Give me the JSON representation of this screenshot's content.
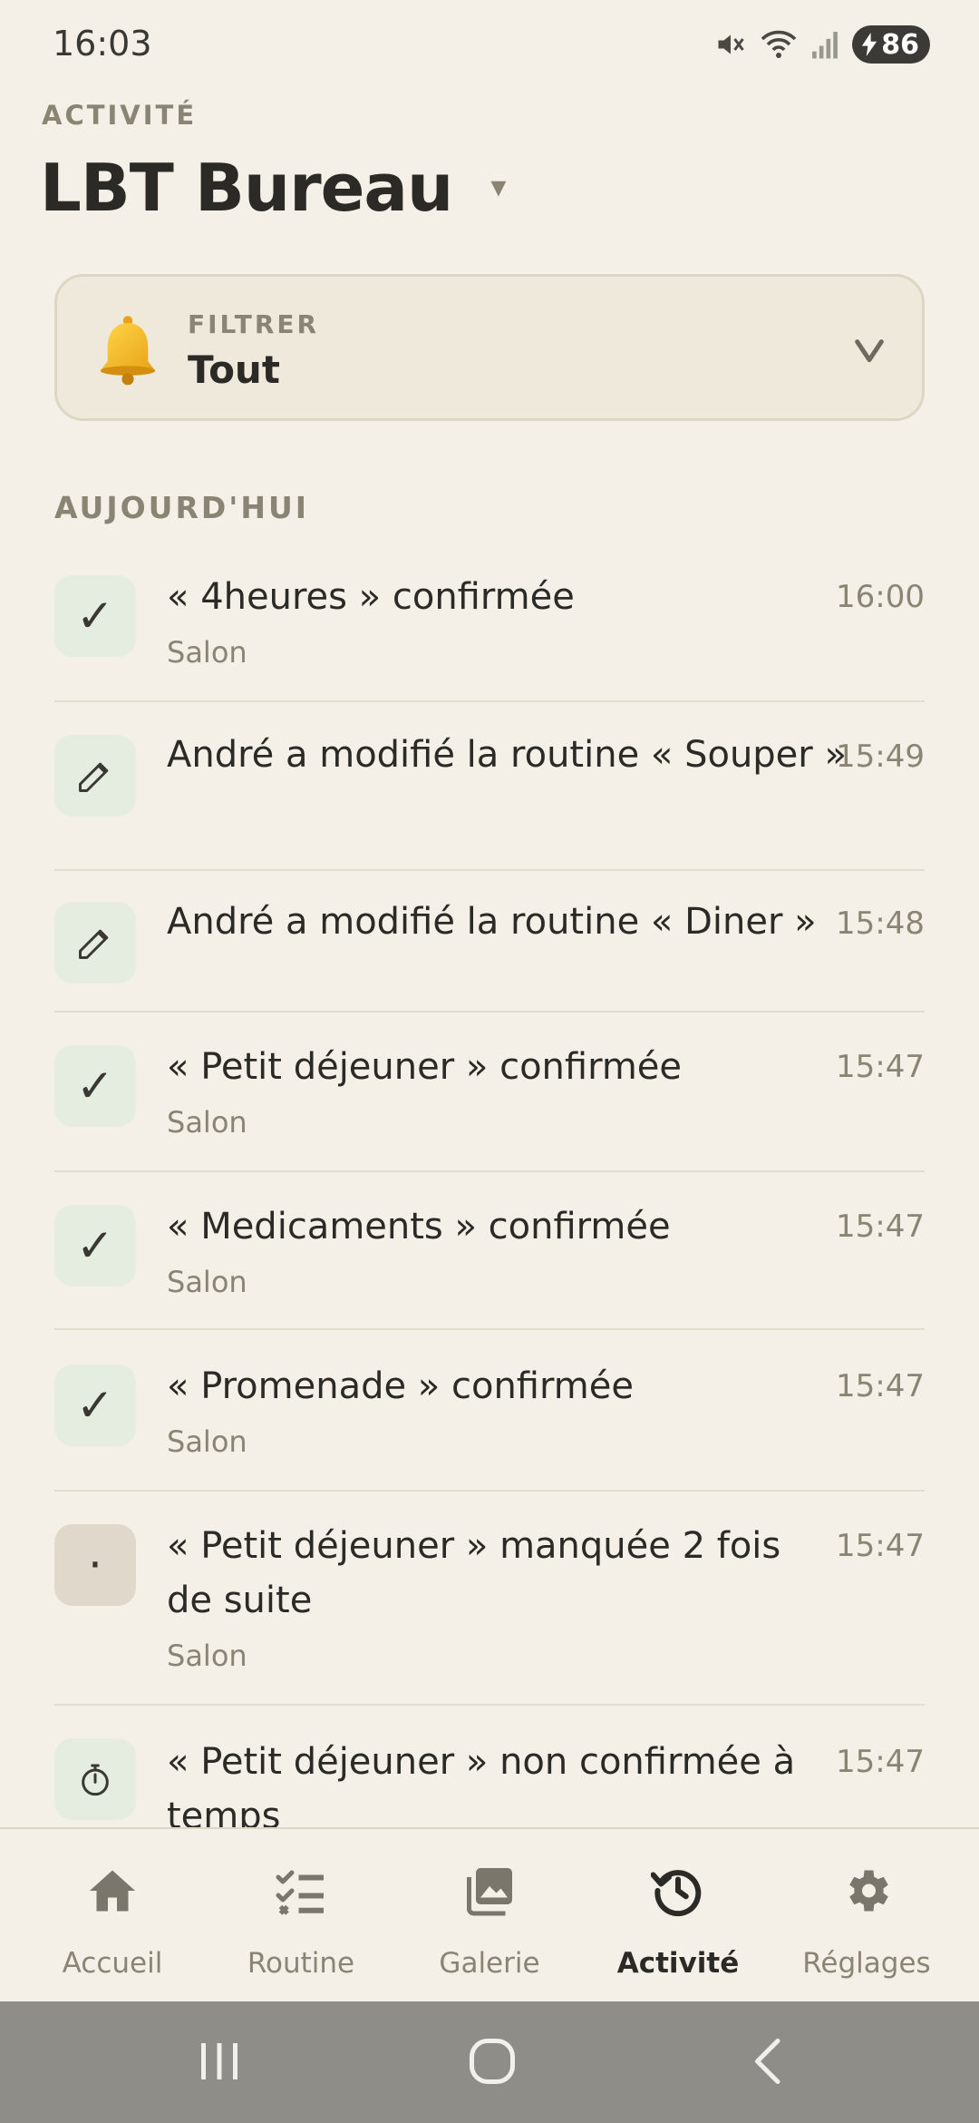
{
  "status": {
    "time": "16:03",
    "battery": "86"
  },
  "header": {
    "eyebrow": "ACTIVITÉ",
    "title": "LBT Bureau",
    "caret": "▾"
  },
  "filter": {
    "label": "FILTRER",
    "value": "Tout",
    "chevron": "v"
  },
  "section": {
    "label": "AUJOURD'HUI"
  },
  "items": [
    {
      "type": "confirmed",
      "icon": "check-icon",
      "glyph": "✓",
      "title": "« 4heures » confirmée",
      "sub": "Salon",
      "time": "16:00"
    },
    {
      "type": "edit",
      "icon": "pencil-icon",
      "glyph": "✎",
      "title": "André a modifié la routine « Souper »",
      "sub": "",
      "time": "15:49"
    },
    {
      "type": "edit",
      "icon": "pencil-icon",
      "glyph": "✎",
      "title": "André a modifié la routine « Diner »",
      "sub": "",
      "time": "15:48"
    },
    {
      "type": "confirmed",
      "icon": "check-icon",
      "glyph": "✓",
      "title": "« Petit déjeuner » confirmée",
      "sub": "Salon",
      "time": "15:47"
    },
    {
      "type": "confirmed",
      "icon": "check-icon",
      "glyph": "✓",
      "title": "« Medicaments » confirmée",
      "sub": "Salon",
      "time": "15:47"
    },
    {
      "type": "confirmed",
      "icon": "check-icon",
      "glyph": "✓",
      "title": "« Promenade » confirmée",
      "sub": "Salon",
      "time": "15:47"
    },
    {
      "type": "missed",
      "icon": "dot-icon",
      "glyph": "·",
      "title": "« Petit déjeuner » manquée 2 fois de suite",
      "sub": "Salon",
      "time": "15:47"
    },
    {
      "type": "late",
      "icon": "stopwatch-icon",
      "glyph": "⏱",
      "title": "« Petit déjeuner » non confirmée à temps",
      "sub": "",
      "time": "15:47"
    }
  ],
  "nav": {
    "items": [
      {
        "label": "Accueil",
        "icon": "home-icon"
      },
      {
        "label": "Routine",
        "icon": "checklist-icon"
      },
      {
        "label": "Galerie",
        "icon": "gallery-icon"
      },
      {
        "label": "Activité",
        "icon": "history-icon",
        "active": true
      },
      {
        "label": "Réglages",
        "icon": "gear-icon"
      }
    ]
  },
  "colors": {
    "background": "#f4f0e7",
    "card": "#efe9dc",
    "muted": "#8a8475",
    "text": "#2b2a26",
    "icon_bg_ok": "#e4ede0",
    "icon_bg_missed": "#e0d9cb",
    "system_nav": "#8f8d88"
  }
}
